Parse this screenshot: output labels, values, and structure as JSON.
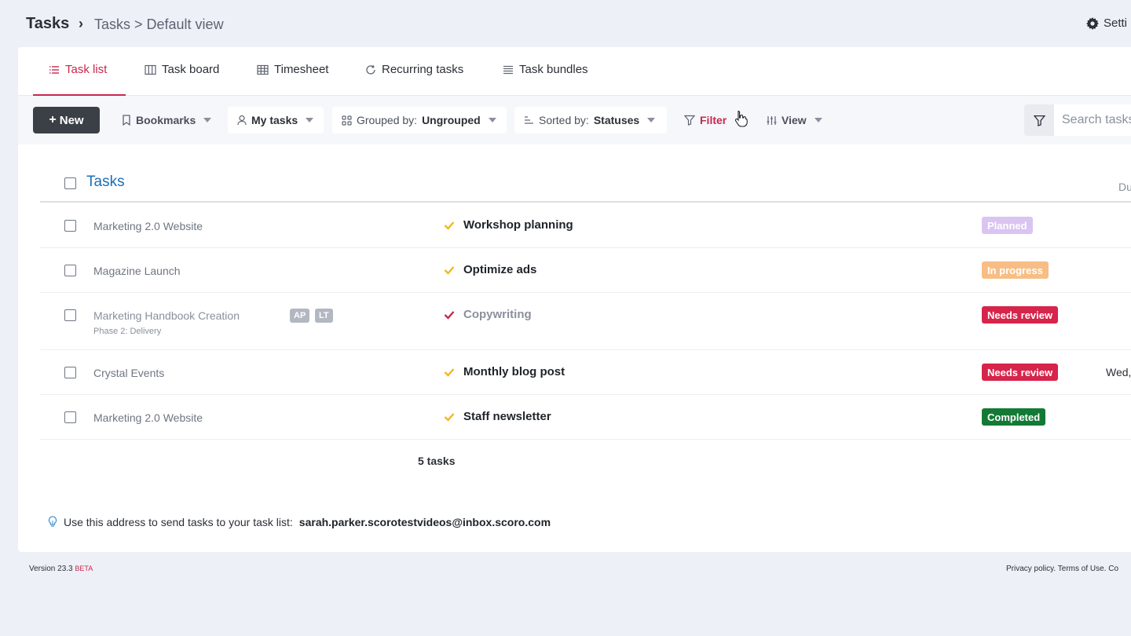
{
  "header": {
    "title": "Tasks",
    "separator": "›",
    "breadcrumb": "Tasks > Default view",
    "settings_label": "Setti"
  },
  "tabs": [
    {
      "label": "Task list",
      "icon": "list-icon",
      "active": true
    },
    {
      "label": "Task board",
      "icon": "board-icon",
      "active": false
    },
    {
      "label": "Timesheet",
      "icon": "grid-icon",
      "active": false
    },
    {
      "label": "Recurring tasks",
      "icon": "refresh-icon",
      "active": false
    },
    {
      "label": "Task bundles",
      "icon": "bundle-icon",
      "active": false
    }
  ],
  "toolbar": {
    "new_label": "New",
    "bookmarks_label": "Bookmarks",
    "my_tasks_label": "My tasks",
    "grouped_prefix": "Grouped by:",
    "grouped_value": "Ungrouped",
    "sorted_prefix": "Sorted by:",
    "sorted_value": "Statuses",
    "filter_label": "Filter",
    "view_label": "View",
    "search_placeholder": "Search tasks"
  },
  "list": {
    "heading": "Tasks",
    "due_column": "Du",
    "rows": [
      {
        "project": "Marketing 2.0 Website",
        "task": "Workshop planning",
        "status": "Planned",
        "check_color": "#f2b81c",
        "badge_color": "#d9c4f2",
        "due": ""
      },
      {
        "project": "Magazine Launch",
        "task": "Optimize ads",
        "status": "In progress",
        "check_color": "#f2b81c",
        "badge_color": "#f6be85",
        "due": ""
      },
      {
        "project": "Marketing Handbook Creation",
        "sub": "Phase 2: Delivery",
        "avatars": [
          "AP",
          "LT"
        ],
        "task": "Copywriting",
        "status": "Needs review",
        "check_color": "#c8284e",
        "badge_color": "#d6244b",
        "due": ""
      },
      {
        "project": "Crystal Events",
        "task": "Monthly blog post",
        "status": "Needs review",
        "check_color": "#f2b81c",
        "badge_color": "#d6244b",
        "due": "Wed,"
      },
      {
        "project": "Marketing 2.0 Website",
        "task": "Staff newsletter",
        "status": "Completed",
        "check_color": "#f2b81c",
        "badge_color": "#127a35",
        "due": ""
      }
    ],
    "count_label": "5 tasks"
  },
  "hint": {
    "text": "Use this address to send tasks to your task list:",
    "email": "sarah.parker.scorotestvideos@inbox.scoro.com"
  },
  "footer": {
    "version": "Version 23.3",
    "beta": "BETA",
    "links": "Privacy policy. Terms of Use. Co"
  },
  "colors": {
    "accent": "#c8284e",
    "link_blue": "#1c6fb3",
    "dark_button": "#3b3f46"
  }
}
